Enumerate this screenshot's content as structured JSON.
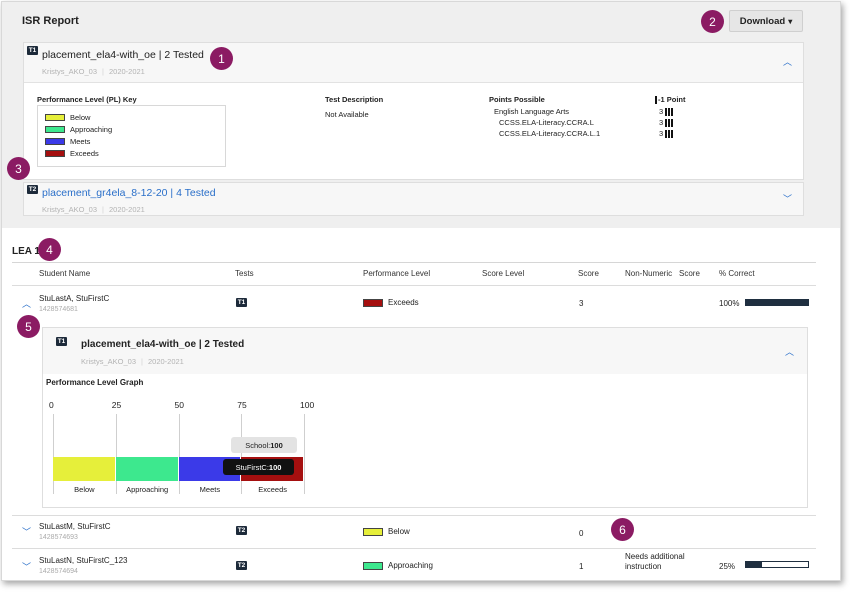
{
  "report": {
    "title": "ISR Report",
    "download_label": "Download",
    "caret": "▾"
  },
  "test1": {
    "badge": "T1",
    "title": "placement_ela4-with_oe | 2 Tested",
    "teacher": "Kristys_AKO_03",
    "year": "2020-2021",
    "pl_key_title": "Performance Level (PL) Key",
    "key": [
      {
        "label": "Below",
        "color": "#e6ef3a"
      },
      {
        "label": "Approaching",
        "color": "#3de88e"
      },
      {
        "label": "Meets",
        "color": "#3b3ae8"
      },
      {
        "label": "Exceeds",
        "color": "#a50f0f"
      }
    ],
    "desc_title": "Test Description",
    "desc_value": "Not Available",
    "points_title": "Points Possible",
    "points_header": "-1 Point",
    "points": [
      {
        "label": "English Language Arts",
        "value": "3"
      },
      {
        "label": "CCSS.ELA-Literacy.CCRA.L",
        "value": "3"
      },
      {
        "label": "CCSS.ELA-Literacy.CCRA.L.1",
        "value": "3"
      }
    ]
  },
  "test2": {
    "badge": "T2",
    "title": "placement_gr4ela_8-12-20 | 4 Tested",
    "teacher": "Kristys_AKO_03",
    "year": "2020-2021"
  },
  "lea": {
    "title": "LEA 1",
    "headers": [
      "Student Name",
      "Tests",
      "Performance Level",
      "Score Level",
      "Score",
      "Non-Numeric",
      "Score",
      "% Correct"
    ],
    "students": [
      {
        "name": "StuLastA, StuFirstC",
        "id": "1428574681",
        "test": "T1",
        "level": "Exceeds",
        "level_color": "#a50f0f",
        "score": "3",
        "non_numeric": "",
        "pct": "100%",
        "pct_value": 100
      },
      {
        "name": "StuLastM, StuFirstC",
        "id": "1428574693",
        "test": "T2",
        "level": "Below",
        "level_color": "#e6ef3a",
        "score": "0",
        "non_numeric": "",
        "pct": "",
        "pct_value": null
      },
      {
        "name": "StuLastN, StuFirstC_123",
        "id": "1428574694",
        "test": "T2",
        "level": "Approaching",
        "level_color": "#3de88e",
        "score": "1",
        "non_numeric": "Needs additional instruction",
        "pct": "25%",
        "pct_value": 25
      }
    ],
    "expanded": {
      "badge": "T1",
      "title": "placement_ela4-with_oe | 2 Tested",
      "teacher": "Kristys_AKO_03",
      "year": "2020-2021",
      "graph_title": "Performance Level Graph",
      "tooltip_school_label": "School: ",
      "tooltip_school_value": "100",
      "tooltip_student_label": "StuFirstC: ",
      "tooltip_student_value": "100"
    }
  },
  "chart_data": {
    "type": "bar",
    "title": "Performance Level Graph",
    "ticks": [
      "0",
      "25",
      "50",
      "75",
      "100"
    ],
    "xlim": [
      0,
      100
    ],
    "segments": [
      {
        "name": "Below",
        "from": 0,
        "to": 25,
        "color": "#e6ef3a"
      },
      {
        "name": "Approaching",
        "from": 25,
        "to": 50,
        "color": "#3de88e"
      },
      {
        "name": "Meets",
        "from": 50,
        "to": 75,
        "color": "#3b3ae8"
      },
      {
        "name": "Exceeds",
        "from": 75,
        "to": 100,
        "color": "#a50f0f"
      }
    ],
    "markers": [
      {
        "name": "School",
        "value": 100
      },
      {
        "name": "StuFirstC",
        "value": 100
      }
    ]
  },
  "callouts": [
    "1",
    "2",
    "3",
    "4",
    "5",
    "6"
  ]
}
